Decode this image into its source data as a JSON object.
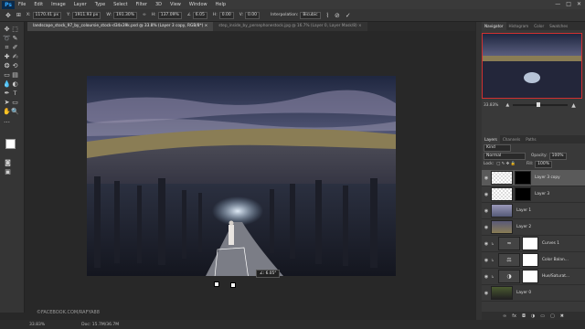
{
  "app": {
    "logo": "Ps"
  },
  "menu": [
    "File",
    "Edit",
    "Image",
    "Layer",
    "Type",
    "Select",
    "Filter",
    "3D",
    "View",
    "Window",
    "Help"
  ],
  "window_controls": [
    "—",
    "□",
    "✕"
  ],
  "options": {
    "x_label": "X:",
    "x_value": "1170.41 px",
    "y_label": "Y:",
    "y_value": "1911.93 px",
    "w_label": "W:",
    "w_value": "191.30%",
    "h_label": "H:",
    "h_value": "137.09%",
    "angle_value": "6.05",
    "h2_label": "H:",
    "h2_value": "0.00",
    "v_label": "V:",
    "v_value": "0.00",
    "interp_label": "Interpolation:",
    "interp_value": "Bicubic",
    "cancel_icon": "cancel-icon",
    "commit_icon": "commit-icon"
  },
  "tabs": [
    {
      "label": "landscape_stock_97_by_coloursie_stock-d34x39k.psd @ 33.8% (Layer 3 copy, RGB/8*) ×"
    },
    {
      "label": "step_inside_by_persephonestock.jpg @ 16.7% (Layer 0, Layer Mask/8) ×"
    }
  ],
  "canvas": {
    "angle_readout": "∠: 6.05°",
    "watermark": "©FACEBOOK.COM/RAFYA88"
  },
  "status": {
    "zoom": "33.83%",
    "doc": "Doc: 15.7M/36.7M"
  },
  "navigator": {
    "tabs": [
      "Navigator",
      "Histogram",
      "Color",
      "Swatches"
    ],
    "zoom": "33.83%"
  },
  "layers_panel": {
    "tabs": [
      "Layers",
      "Channels",
      "Paths"
    ],
    "kind_label": "Kind",
    "blend_mode": "Normal",
    "opacity_label": "Opacity:",
    "opacity_value": "100%",
    "lock_label": "Lock:",
    "fill_label": "Fill:",
    "fill_value": "100%",
    "layers": [
      {
        "name": "Layer 3 copy"
      },
      {
        "name": "Layer 3"
      },
      {
        "name": "Layer 1"
      },
      {
        "name": "Layer 2"
      },
      {
        "name": "Curves 1"
      },
      {
        "name": "Color Balan..."
      },
      {
        "name": "Hue/Saturat..."
      },
      {
        "name": "Layer 0"
      }
    ],
    "footer_icons": [
      "link-icon",
      "fx-icon",
      "mask-icon",
      "adjustment-icon",
      "folder-icon",
      "new-layer-icon",
      "trash-icon"
    ]
  },
  "colors": {
    "accent": "#31a8ff",
    "selection_red": "#d03030"
  }
}
